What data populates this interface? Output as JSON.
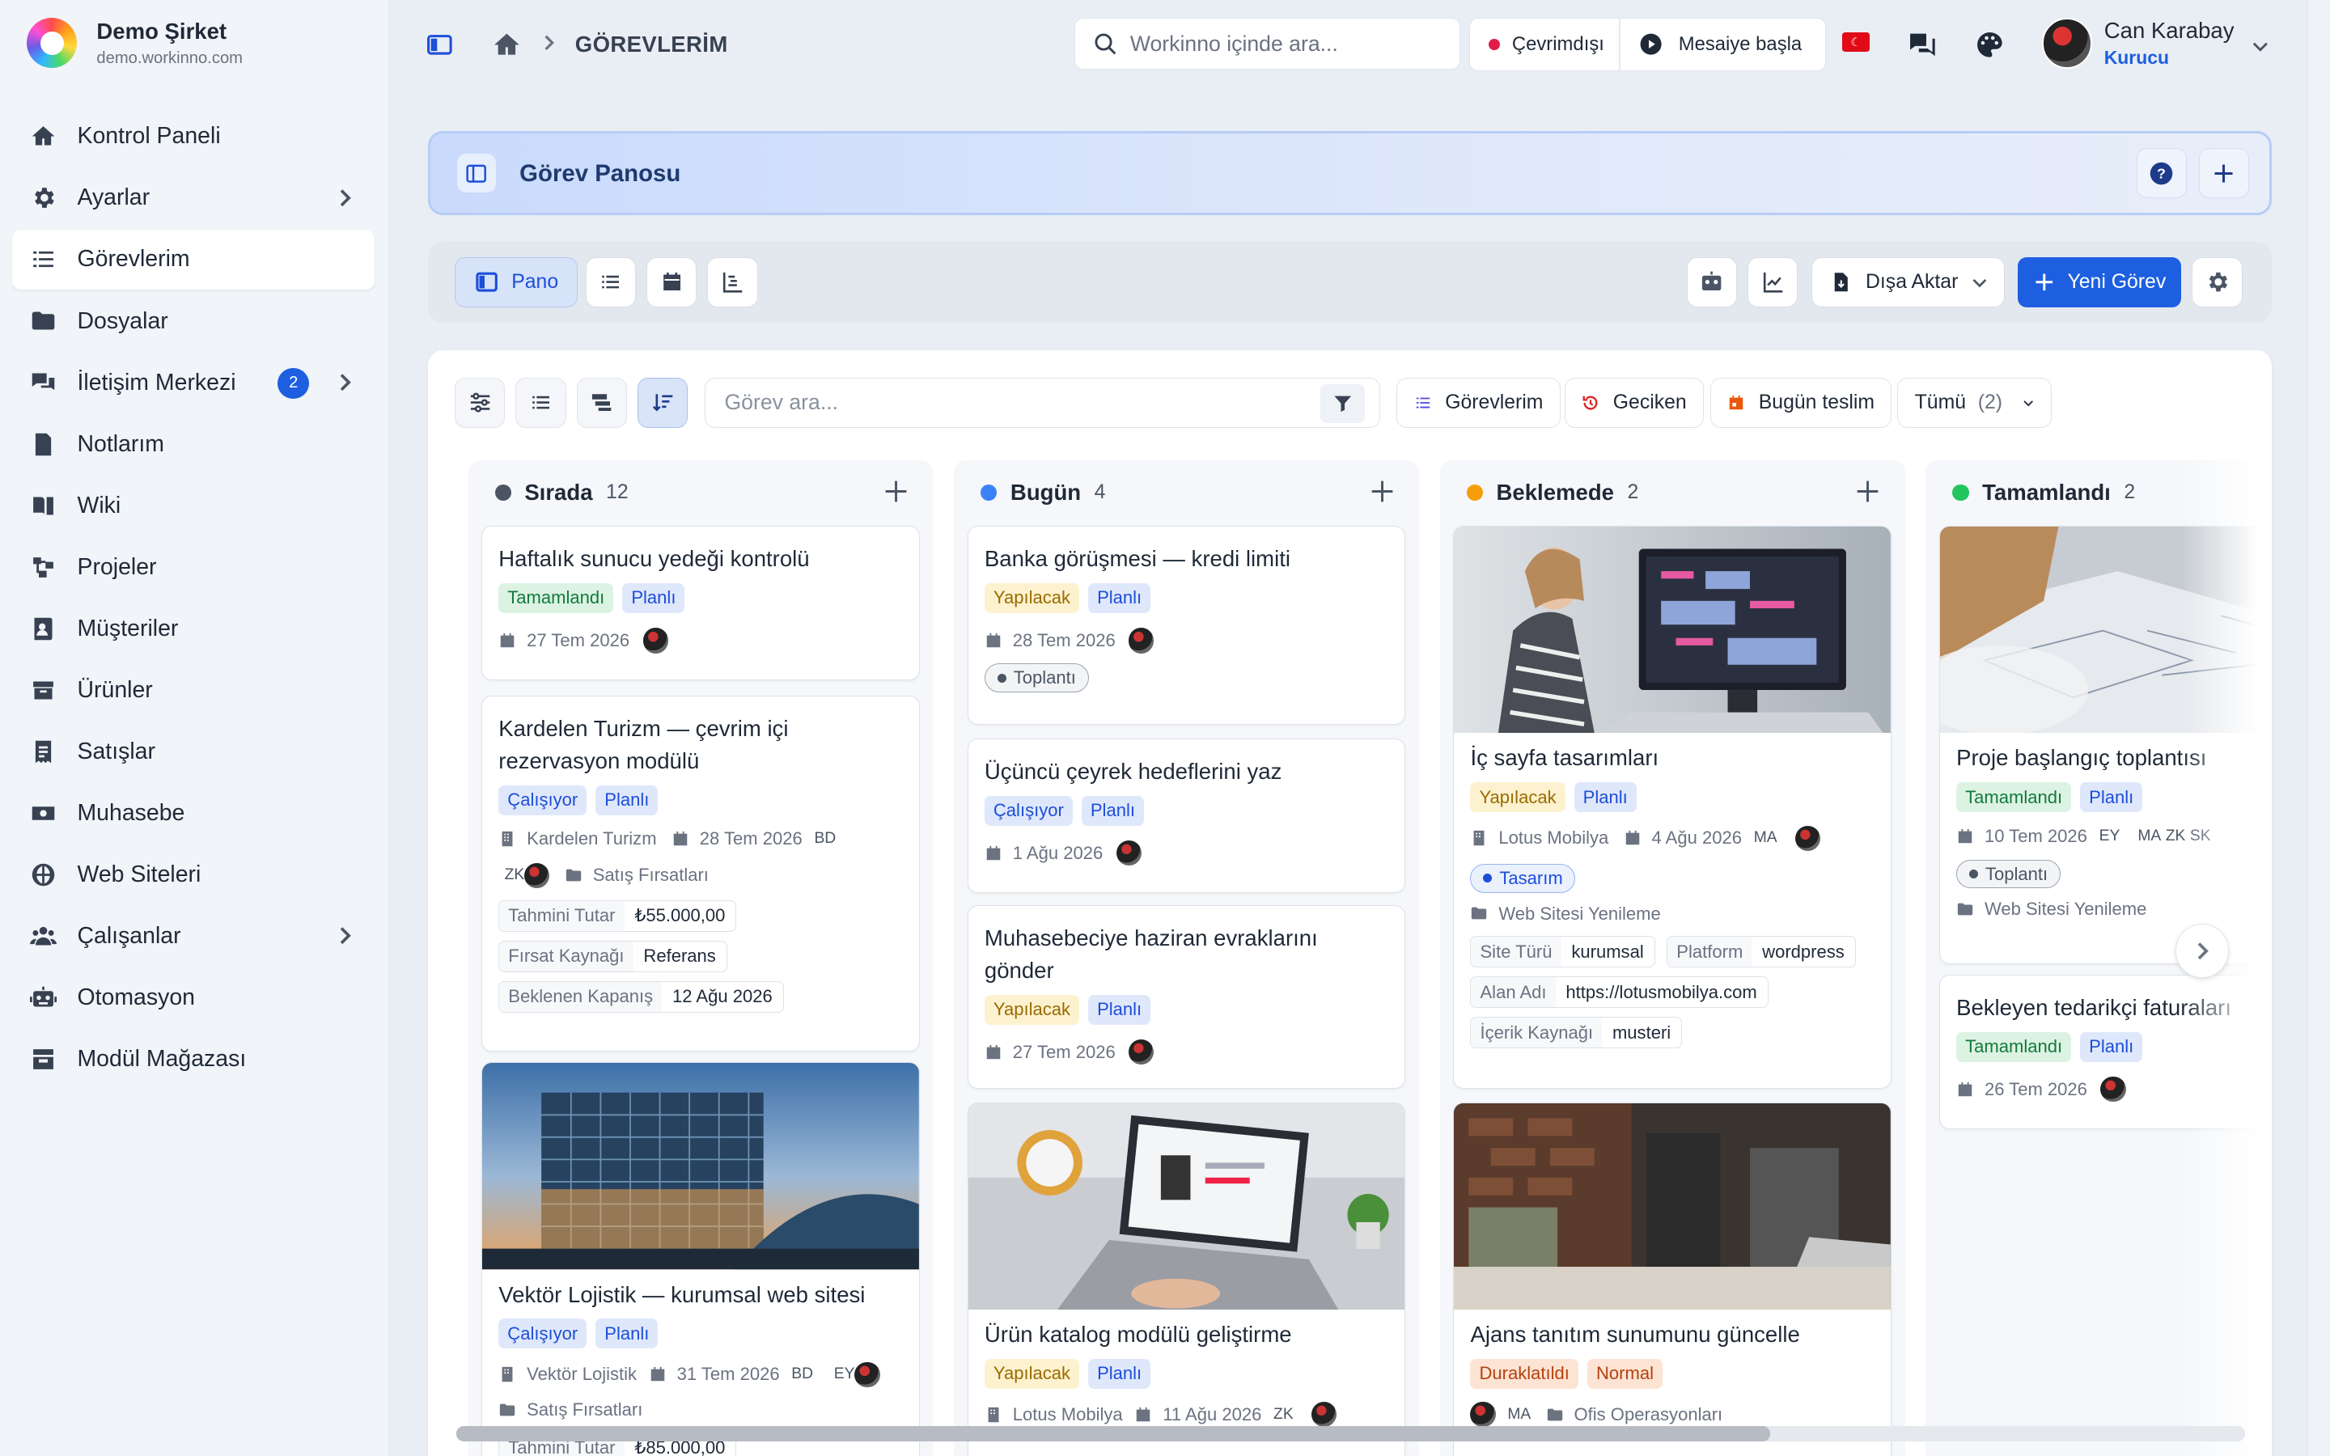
{
  "brand": {
    "name": "Demo Şirket",
    "url": "demo.workinno.com"
  },
  "sidebar": {
    "items": [
      {
        "label": "Kontrol Paneli",
        "icon": "home-icon"
      },
      {
        "label": "Ayarlar",
        "icon": "gear-icon",
        "chevron": true
      },
      {
        "label": "Görevlerim",
        "icon": "checklist-icon",
        "active": true
      },
      {
        "label": "Dosyalar",
        "icon": "folder-icon"
      },
      {
        "label": "İletişim Merkezi",
        "icon": "chat-icon",
        "badge": "2",
        "chevron": true
      },
      {
        "label": "Notlarım",
        "icon": "note-icon"
      },
      {
        "label": "Wiki",
        "icon": "book-icon"
      },
      {
        "label": "Projeler",
        "icon": "project-icon"
      },
      {
        "label": "Müşteriler",
        "icon": "contact-icon"
      },
      {
        "label": "Ürünler",
        "icon": "box-icon"
      },
      {
        "label": "Satışlar",
        "icon": "receipt-icon"
      },
      {
        "label": "Muhasebe",
        "icon": "money-icon"
      },
      {
        "label": "Web Siteleri",
        "icon": "globe-icon"
      },
      {
        "label": "Çalışanlar",
        "icon": "users-icon",
        "chevron": true
      },
      {
        "label": "Otomasyon",
        "icon": "robot-icon"
      },
      {
        "label": "Modül Mağazası",
        "icon": "store-icon"
      }
    ]
  },
  "topbar": {
    "breadcrumb": "GÖREVLERİM",
    "search_placeholder": "Workinno içinde ara...",
    "status": "Çevrimdışı",
    "shift": "Mesaiye başla",
    "flag": "TR"
  },
  "user": {
    "name": "Can Karabay",
    "role": "Kurucu"
  },
  "header": {
    "title": "Görev Panosu",
    "help": "?"
  },
  "toolbar": {
    "view_board": "Pano",
    "export": "Dışa Aktar",
    "new_task": "Yeni Görev"
  },
  "filters": {
    "search_placeholder": "Görev ara...",
    "mine": "Görevlerim",
    "overdue": "Geciken",
    "due_today": "Bugün teslim",
    "scope": "Tümü",
    "scope_count": "(2)"
  },
  "columns": [
    {
      "name": "Sırada",
      "count": "12",
      "color": "#4b5563"
    },
    {
      "name": "Bugün",
      "count": "4",
      "color": "#3b82f6"
    },
    {
      "name": "Beklemede",
      "count": "2",
      "color": "#f59e0b"
    },
    {
      "name": "Tamamlandı",
      "count": "2",
      "color": "#22c55e"
    }
  ],
  "tasks": {
    "c1": [
      {
        "title": "Haftalık sunucu yedeği kontrolü",
        "status": "Tamamlandı",
        "priority": "Planlı",
        "date": "27 Tem 2026"
      },
      {
        "title": "Kardelen Turizm — çevrim içi rezervasyon modülü",
        "status": "Çalışıyor",
        "priority": "Planlı",
        "company": "Kardelen Turizm",
        "date": "28 Tem 2026",
        "ini1": "BD",
        "ini2": "ZK",
        "pipeline": "Satış Fırsatları",
        "f1k": "Tahmini Tutar",
        "f1v": "₺55.000,00",
        "f2k": "Fırsat Kaynağı",
        "f2v": "Referans",
        "f3k": "Beklenen Kapanış",
        "f3v": "12 Ağu 2026"
      },
      {
        "title": "Vektör Lojistik — kurumsal web sitesi",
        "status": "Çalışıyor",
        "priority": "Planlı",
        "company": "Vektör Lojistik",
        "date": "31 Tem 2026",
        "ini1": "BD",
        "ini2": "EY",
        "pipeline": "Satış Fırsatları",
        "f1k": "Tahmini Tutar",
        "f1v": "₺85.000,00"
      }
    ],
    "c2": [
      {
        "title": "Banka görüşmesi — kredi limiti",
        "status": "Yapılacak",
        "priority": "Planlı",
        "date": "28 Tem 2026",
        "label": "Toplantı"
      },
      {
        "title": "Üçüncü çeyrek hedeflerini yaz",
        "status": "Çalışıyor",
        "priority": "Planlı",
        "date": "1 Ağu 2026"
      },
      {
        "title": "Muhasebeciye haziran evraklarını gönder",
        "status": "Yapılacak",
        "priority": "Planlı",
        "date": "27 Tem 2026"
      },
      {
        "title": "Ürün katalog modülü geliştirme",
        "status": "Yapılacak",
        "priority": "Planlı",
        "company": "Lotus Mobilya",
        "date": "11 Ağu 2026",
        "ini": "ZK"
      }
    ],
    "c3": [
      {
        "title": "İç sayfa tasarımları",
        "status": "Yapılacak",
        "priority": "Planlı",
        "company": "Lotus Mobilya",
        "date": "4 Ağu 2026",
        "ini": "MA",
        "label": "Tasarım",
        "project": "Web Sitesi Yenileme",
        "f1k": "Site Türü",
        "f1v": "kurumsal",
        "f2k": "Platform",
        "f2v": "wordpress",
        "f3k": "Alan Adı",
        "f3v": "https://lotusmobilya.com",
        "f4k": "İçerik Kaynağı",
        "f4v": "musteri"
      },
      {
        "title": "Ajans tanıtım sunumunu güncelle",
        "status": "Duraklatıldı",
        "priority": "Normal",
        "ini": "MA",
        "project": "Ofis Operasyonları"
      }
    ],
    "c4": [
      {
        "title": "Proje başlangıç toplantısı",
        "status": "Tamamlandı",
        "priority": "Planlı",
        "date": "10 Tem 2026",
        "ini1": "EY",
        "ini2": "MA",
        "ini3": "ZK",
        "ini4": "SK",
        "label": "Toplantı",
        "project": "Web Sitesi Yenileme"
      },
      {
        "title": "Bekleyen tedarikçi faturaları",
        "status": "Tamamlandı",
        "priority": "Planlı",
        "date": "26 Tem 2026"
      }
    ]
  },
  "colors": {
    "accent": "#1d5fe0",
    "sidebar_bg": "#f1f4f8",
    "header_bg": "#c9dafc"
  }
}
